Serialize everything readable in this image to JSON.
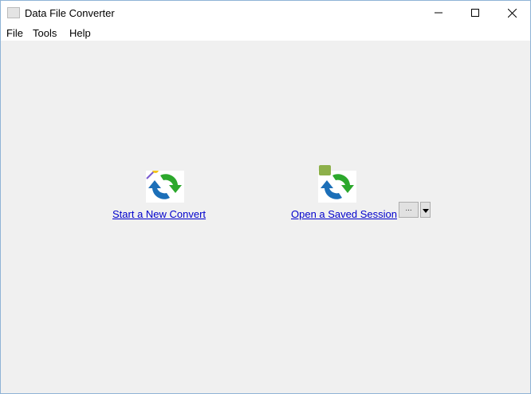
{
  "window": {
    "title": "Data File Converter"
  },
  "menu": [
    "File",
    "Tools",
    "Help"
  ],
  "main": {
    "new_convert": "Start a New Convert",
    "open_session": "Open a Saved Session",
    "browse_label": "..."
  },
  "colors": {
    "link": "#0000cc",
    "arrow_green": "#2ca82c",
    "arrow_blue": "#1c6fb8"
  }
}
